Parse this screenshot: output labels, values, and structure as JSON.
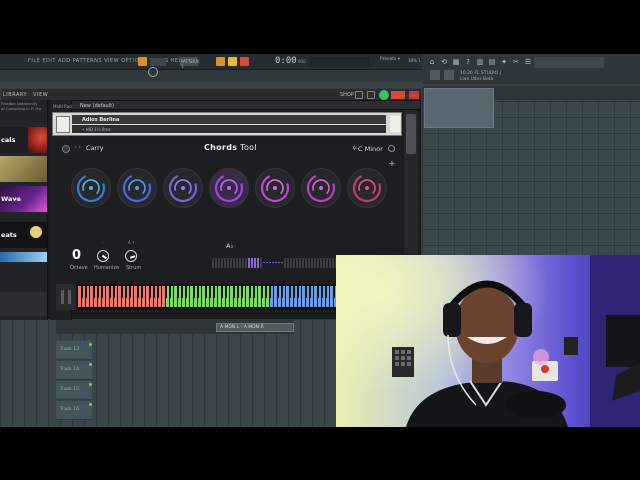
{
  "fl": {
    "menu": "FILE  EDIT  ADD  PATTERNS  VIEW  OPTIONS  TOOLS  HELP",
    "pattern_label": "PATTERN 1",
    "time": "0:00",
    "time_suffix": "000",
    "cpu_label": "18% 1",
    "hint_line1": "10.26 FL STUDIO |",
    "hint_line2": "Live Ulter Beta",
    "tool_colors": [
      "#e08b2c",
      "#d94a3a",
      "#e9b93c",
      "#6ac46b"
    ]
  },
  "kontakt": {
    "tabs": "LIBRARY  VIEW",
    "shop": "SHOP",
    "browser_head_1": "Flexible        Nationality",
    "browser_head_2": "of Compiling     In Fl Pro",
    "tiles": [
      {
        "label": "cals",
        "color": "#1e1e22",
        "accent": "#d2453a"
      },
      {
        "label": "",
        "color": "#b8a86a",
        "accent": "#5a4a2a"
      },
      {
        "label": "Wave",
        "color": "#4a1f6a",
        "accent": "#e05ad0"
      },
      {
        "label": "eats",
        "color": "#141416",
        "accent": "#e6d27a"
      }
    ],
    "multi_rack": "Multi Rack",
    "multi_name": "New (default)",
    "instrument_name": "Adios Berlina",
    "instrument_sub": "•  HID 1½         0ms·"
  },
  "chords_tool": {
    "preset": "Carry",
    "nav": "‹  ›",
    "logo_bold": "Chords",
    "logo_light": " Tool",
    "key": "C Minor",
    "key_icon": "✲",
    "plus_icon": "✚",
    "pads": [
      {
        "ring": "#3a78d8",
        "glow": "#5ab0e8"
      },
      {
        "ring": "#4a68e0",
        "glow": "#6a90f0"
      },
      {
        "ring": "#7a60e0",
        "glow": "#8f80f0"
      },
      {
        "ring": "#9a4ae0",
        "glow": "#c068f0"
      },
      {
        "ring": "#c042d8",
        "glow": "#d86ae8"
      },
      {
        "ring": "#c23cc8",
        "glow": "#dc60d8"
      },
      {
        "ring": "#c03a70",
        "glow": "#d85a80"
      }
    ],
    "active_pad": 4,
    "octave_value": "0",
    "octave_label": "Octave",
    "humanize_label": "Humanize",
    "strum_label": "Strum",
    "knob_hint": "A ↑",
    "humanize_hint": "–",
    "chord_name": "A♭"
  },
  "channel": {
    "select_label": "A MON L - A MON R",
    "tracks": [
      "Track 13",
      "Track 14",
      "Track 15",
      "Track 16"
    ]
  },
  "colors": {
    "kb_red": "#e57a6e",
    "kb_green": "#7cdb64",
    "kb_blue": "#6c9ee8"
  }
}
